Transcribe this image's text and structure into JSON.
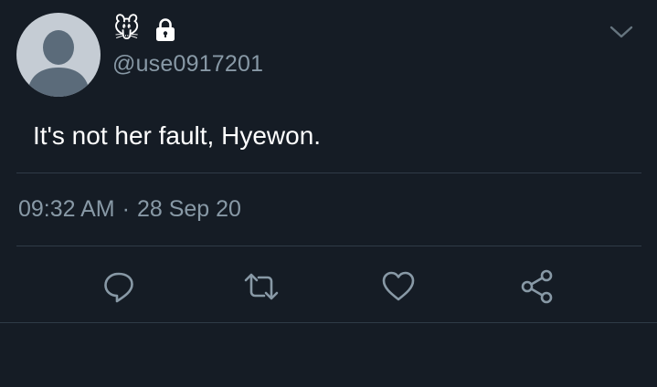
{
  "user": {
    "emoji": "🐭",
    "handle": "@use0917201",
    "protected_icon": "lock-icon",
    "avatar_icon": "default-avatar-icon"
  },
  "tweet": {
    "text": "It's not her fault, Hyewon.",
    "time": "09:32 AM",
    "separator": "·",
    "date": "28 Sep 20"
  },
  "actions": [
    "reply-icon",
    "retweet-icon",
    "like-icon",
    "share-icon"
  ],
  "colors": {
    "background": "#151c25",
    "text": "#ffffff",
    "secondary_text": "#8899a6",
    "divider": "#2f3b47",
    "avatar_bg": "#c5ccd4",
    "avatar_silhouette": "#5b6b7a"
  }
}
